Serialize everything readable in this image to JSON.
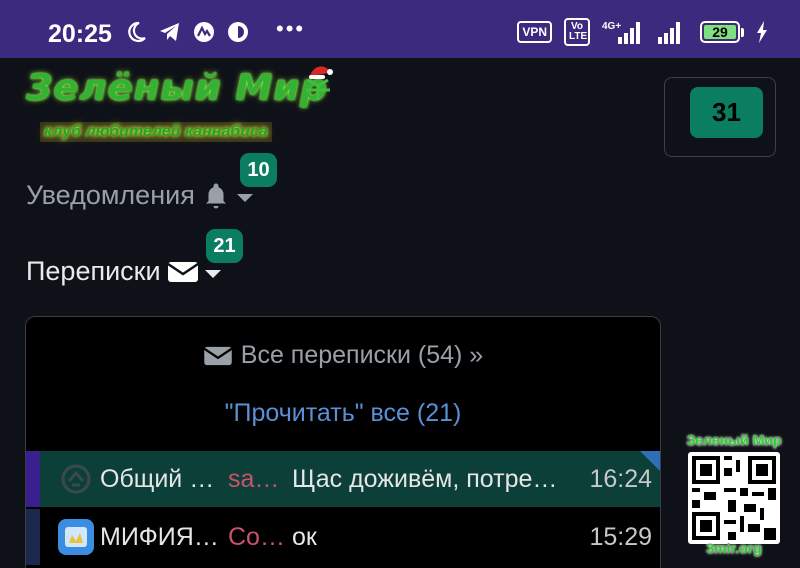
{
  "status_bar": {
    "time": "20:25",
    "vpn": "VPN",
    "volte": "Vo LTE",
    "network": "4G+",
    "battery": "29"
  },
  "logo": {
    "title": "Зелёный Мир",
    "subtitle": "клуб любителей каннабиса"
  },
  "counter": {
    "value": "31"
  },
  "notifications": {
    "label": "Уведомления",
    "badge": "10"
  },
  "conversations": {
    "label": "Переписки",
    "badge": "21"
  },
  "panel": {
    "all_label": "Все переписки (54) »",
    "read_all_label": "\"Прочитать\" все (21)",
    "rows": [
      {
        "title": "Общий …",
        "author": "sa…",
        "message": "Щас доживём, потре…",
        "time": "16:24"
      },
      {
        "title": "МИФИЯ…",
        "author": "Co…",
        "message": "ок",
        "time": "15:29"
      }
    ]
  },
  "watermark": {
    "top": "Зеленый Мир",
    "bottom": "3mir.org"
  },
  "colors": {
    "status_bar": "#3c2a7e",
    "badge": "#0b7d61",
    "link": "#5b8fd6",
    "active_row": "#0b3f38",
    "author": "#c9546a"
  }
}
